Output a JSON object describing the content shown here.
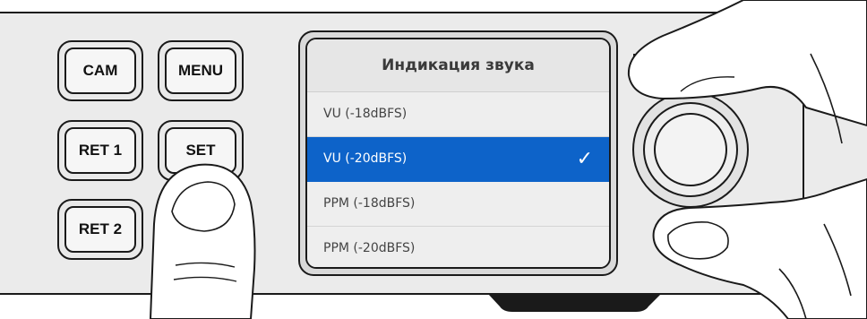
{
  "hardware_buttons": {
    "cam": "CAM",
    "menu": "MENU",
    "ret1": "RET 1",
    "set": "SET",
    "ret2": "RET 2"
  },
  "lcd_menu": {
    "title": "Индикация звука",
    "items": [
      {
        "label": "VU (-18dBFS)",
        "selected": false
      },
      {
        "label": "VU (-20dBFS)",
        "selected": true
      },
      {
        "label": "PPM (-18dBFS)",
        "selected": false
      },
      {
        "label": "PPM (-20dBFS)",
        "selected": false
      }
    ],
    "selected_icon": "checkmark-icon",
    "accent_color": "#0d63c9"
  }
}
